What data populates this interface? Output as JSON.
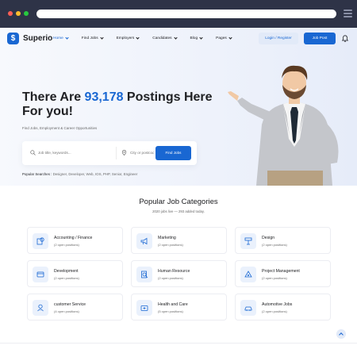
{
  "brand": {
    "name": "Superio",
    "accent": "#1967d2"
  },
  "nav": {
    "items": [
      {
        "label": "Home",
        "active": true
      },
      {
        "label": "Find Jobs"
      },
      {
        "label": "Employers"
      },
      {
        "label": "Candidates"
      },
      {
        "label": "Blog"
      },
      {
        "label": "Pages"
      }
    ],
    "login_label": "Login / Register",
    "post_label": "Job Post",
    "bell_icon": "bell-icon"
  },
  "hero": {
    "title_prefix": "There Are ",
    "title_count": "93,178",
    "title_suffix": " Postings Here For you!",
    "subtitle": "Find Jobs, Employment & Career Opportunities",
    "search_placeholder": "Job title, keywords...",
    "location_placeholder": "City or postcode",
    "find_label": "Find Jobs",
    "popular_label": "Popular Searches : ",
    "popular_terms": "Designer, Developer, Web, IOS, PHP, Senior, Engineer"
  },
  "categories": {
    "title": "Popular Job Categories",
    "subtitle": "2020 jobs live — 293 added today.",
    "items": [
      {
        "name": "Accounting / Finance",
        "count": "(2 open positions)",
        "icon": "finance-icon"
      },
      {
        "name": "Marketing",
        "count": "(2 open positions)",
        "icon": "megaphone-icon"
      },
      {
        "name": "Design",
        "count": "(2 open positions)",
        "icon": "design-icon"
      },
      {
        "name": "Development",
        "count": "(2 open positions)",
        "icon": "development-icon"
      },
      {
        "name": "Human Resource",
        "count": "(2 open positions)",
        "icon": "hr-icon"
      },
      {
        "name": "Project Management",
        "count": "(2 open positions)",
        "icon": "project-icon"
      },
      {
        "name": "customer Service",
        "count": "(4 open positions)",
        "icon": "customer-icon"
      },
      {
        "name": "Health and Care",
        "count": "(5 open positions)",
        "icon": "health-icon"
      },
      {
        "name": "Automotive Jobs",
        "count": "(2 open positions)",
        "icon": "car-icon"
      }
    ]
  }
}
